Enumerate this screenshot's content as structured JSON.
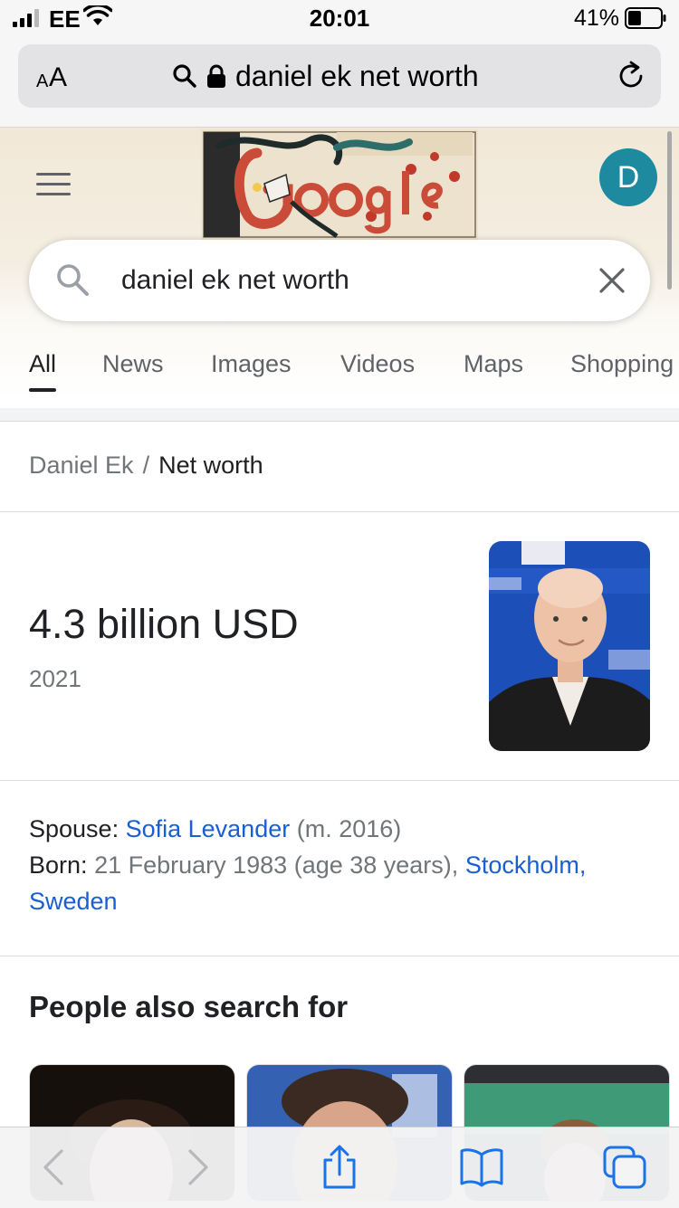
{
  "status_bar": {
    "carrier": "EE",
    "time": "20:01",
    "battery_percent": "41%",
    "battery_level": 0.41
  },
  "safari": {
    "reader_label_small": "A",
    "reader_label_large": "A",
    "url": "daniel ek net worth"
  },
  "google": {
    "avatar_letter": "D",
    "search_query": "daniel ek net worth",
    "tabs": [
      {
        "label": "All",
        "active": true
      },
      {
        "label": "News",
        "active": false
      },
      {
        "label": "Images",
        "active": false
      },
      {
        "label": "Videos",
        "active": false
      },
      {
        "label": "Maps",
        "active": false
      },
      {
        "label": "Shopping",
        "active": false
      }
    ]
  },
  "answer": {
    "breadcrumb_parent": "Daniel Ek",
    "breadcrumb_separator": "/",
    "breadcrumb_current": "Net worth",
    "value": "4.3 billion USD",
    "year": "2021"
  },
  "facts": {
    "spouse_label": "Spouse:",
    "spouse_name": "Sofia Levander",
    "spouse_note": "(m. 2016)",
    "born_label": "Born:",
    "born_value": "21 February 1983 (age 38 years),",
    "born_place": "Stockholm, Sweden"
  },
  "people_also_search": {
    "title": "People also search for"
  },
  "colors": {
    "link": "#1a5fd1",
    "avatar": "#1e8aa0",
    "muted": "#70757a"
  },
  "icons": [
    "signal-icon",
    "wifi-icon",
    "battery-icon",
    "search-icon",
    "lock-icon",
    "reload-icon",
    "menu-icon",
    "clear-icon",
    "back-icon",
    "forward-icon",
    "share-icon",
    "bookmarks-icon",
    "tabs-icon"
  ]
}
